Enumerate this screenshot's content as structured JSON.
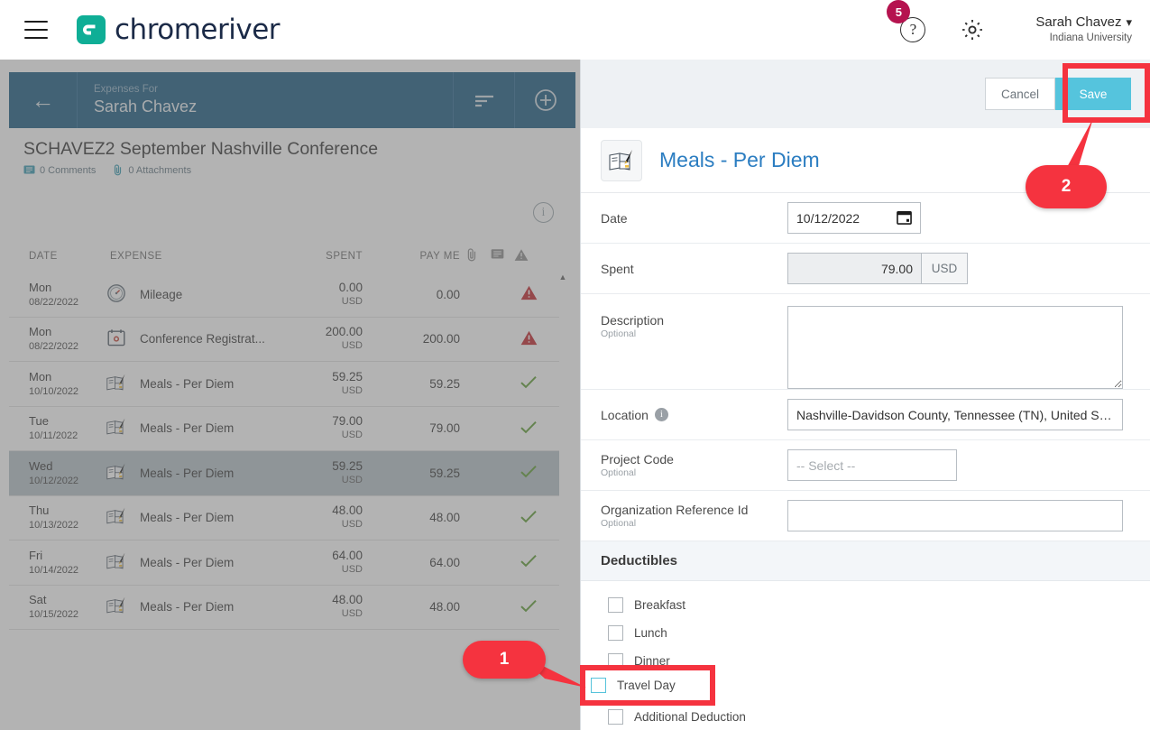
{
  "topbar": {
    "menu_icon": "hamburger-icon",
    "brand_name": "chromeriver",
    "brand_mark": "CR",
    "notification_count": "5",
    "help_icon": "question-mark-icon",
    "settings_icon": "gear-icon",
    "user_name": "Sarah Chavez",
    "user_caret": "⌄",
    "user_org": "Indiana University"
  },
  "left_panel": {
    "back_icon": "back-arrow-icon",
    "header_subtitle": "Expenses For",
    "header_name": "Sarah Chavez",
    "sort_icon": "sort-icon",
    "add_icon": "plus-circle-icon",
    "report_title": "SCHAVEZ2 September Nashville Conference",
    "comments_label": "0 Comments",
    "attachments_label": "0 Attachments",
    "info_icon": "info-circle-icon",
    "columns": {
      "date": "DATE",
      "expense": "EXPENSE",
      "spent": "SPENT",
      "pay_me": "PAY ME",
      "attach_icon": "paperclip-icon",
      "comment_icon": "comment-icon",
      "warn_icon": "warning-triangle-icon"
    },
    "rows": [
      {
        "day": "Mon",
        "date": "08/22/2022",
        "icon": "speedometer-icon",
        "expense": "Mileage",
        "spent": "0.00",
        "currency": "USD",
        "pay_me": "0.00",
        "status": "warning",
        "selected": false
      },
      {
        "day": "Mon",
        "date": "08/22/2022",
        "icon": "calendar-icon",
        "expense": "Conference Registrat...",
        "spent": "200.00",
        "currency": "USD",
        "pay_me": "200.00",
        "status": "warning",
        "selected": false
      },
      {
        "day": "Mon",
        "date": "10/10/2022",
        "icon": "per-diem-icon",
        "expense": "Meals - Per Diem",
        "spent": "59.25",
        "currency": "USD",
        "pay_me": "59.25",
        "status": "ok",
        "selected": false
      },
      {
        "day": "Tue",
        "date": "10/11/2022",
        "icon": "per-diem-icon",
        "expense": "Meals - Per Diem",
        "spent": "79.00",
        "currency": "USD",
        "pay_me": "79.00",
        "status": "ok",
        "selected": false
      },
      {
        "day": "Wed",
        "date": "10/12/2022",
        "icon": "per-diem-icon",
        "expense": "Meals - Per Diem",
        "spent": "59.25",
        "currency": "USD",
        "pay_me": "59.25",
        "status": "ok",
        "selected": true
      },
      {
        "day": "Thu",
        "date": "10/13/2022",
        "icon": "per-diem-icon",
        "expense": "Meals - Per Diem",
        "spent": "48.00",
        "currency": "USD",
        "pay_me": "48.00",
        "status": "ok",
        "selected": false
      },
      {
        "day": "Fri",
        "date": "10/14/2022",
        "icon": "per-diem-icon",
        "expense": "Meals - Per Diem",
        "spent": "64.00",
        "currency": "USD",
        "pay_me": "64.00",
        "status": "ok",
        "selected": false
      },
      {
        "day": "Sat",
        "date": "10/15/2022",
        "icon": "per-diem-icon",
        "expense": "Meals - Per Diem",
        "spent": "48.00",
        "currency": "USD",
        "pay_me": "48.00",
        "status": "ok",
        "selected": false
      }
    ]
  },
  "right_panel": {
    "cancel_label": "Cancel",
    "save_label": "Save",
    "expense_title": "Meals - Per Diem",
    "expense_icon": "per-diem-icon",
    "fields": {
      "date_label": "Date",
      "date_value": "10/12/2022",
      "date_icon": "calendar-icon",
      "spent_label": "Spent",
      "spent_value": "79.00",
      "spent_currency": "USD",
      "description_label": "Description",
      "description_optional": "Optional",
      "description_value": "",
      "location_label": "Location",
      "location_value": "Nashville-Davidson County, Tennessee (TN), United S…",
      "project_code_label": "Project Code",
      "project_code_optional": "Optional",
      "project_code_placeholder": "-- Select --",
      "org_ref_label": "Organization Reference Id",
      "org_ref_optional": "Optional",
      "org_ref_value": ""
    },
    "deductibles": {
      "section_title": "Deductibles",
      "items": [
        {
          "label": "Breakfast",
          "checked": false
        },
        {
          "label": "Lunch",
          "checked": false
        },
        {
          "label": "Dinner",
          "checked": false
        },
        {
          "label": "Travel Day",
          "checked": false
        },
        {
          "label": "Additional Deduction",
          "checked": false
        }
      ]
    }
  },
  "annotations": {
    "callout_1": "1",
    "callout_2": "2",
    "highlight_color": "#f5333f",
    "travel_day_label": "Travel Day"
  },
  "colors": {
    "brand_teal": "#0fae96",
    "header_blue": "#13567e",
    "save_button": "#55c4dd",
    "link_blue": "#2b7dc1",
    "badge_magenta": "#b5134f",
    "annotation_red": "#f5333f",
    "warning_red": "#c02026",
    "ok_green": "#5b9b2f"
  }
}
